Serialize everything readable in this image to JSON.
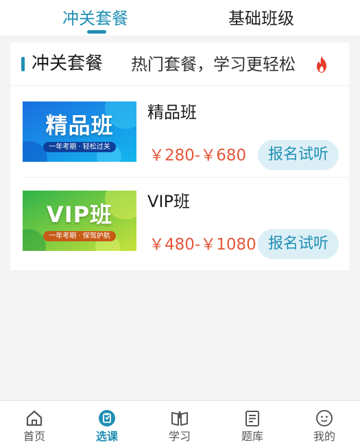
{
  "top_tabs": [
    {
      "label": "冲关套餐",
      "active": true
    },
    {
      "label": "基础班级",
      "active": false
    }
  ],
  "section": {
    "title": "冲关套餐",
    "subtitle": "热门套餐，学习更轻松",
    "icon": "fire-icon"
  },
  "courses": [
    {
      "thumb_title": "精品班",
      "thumb_tag": "一年考期 · 轻松过关",
      "name": "精品班",
      "price": "￥280-￥680",
      "button": "报名试听"
    },
    {
      "thumb_title": "VIP班",
      "thumb_tag": "一年考期 · 保驾护航",
      "name": "VIP班",
      "price": "￥480-￥1080",
      "button": "报名试听"
    }
  ],
  "bottom_nav": [
    {
      "label": "首页",
      "icon": "home-icon",
      "active": false
    },
    {
      "label": "选课",
      "icon": "course-select-icon",
      "active": true
    },
    {
      "label": "学习",
      "icon": "book-icon",
      "active": false
    },
    {
      "label": "题库",
      "icon": "question-bank-icon",
      "active": false
    },
    {
      "label": "我的",
      "icon": "profile-icon",
      "active": false
    }
  ],
  "colors": {
    "accent": "#1f8fb4",
    "price": "#e4573a",
    "button_bg": "#dceff6",
    "fire": "#e63a2a"
  }
}
